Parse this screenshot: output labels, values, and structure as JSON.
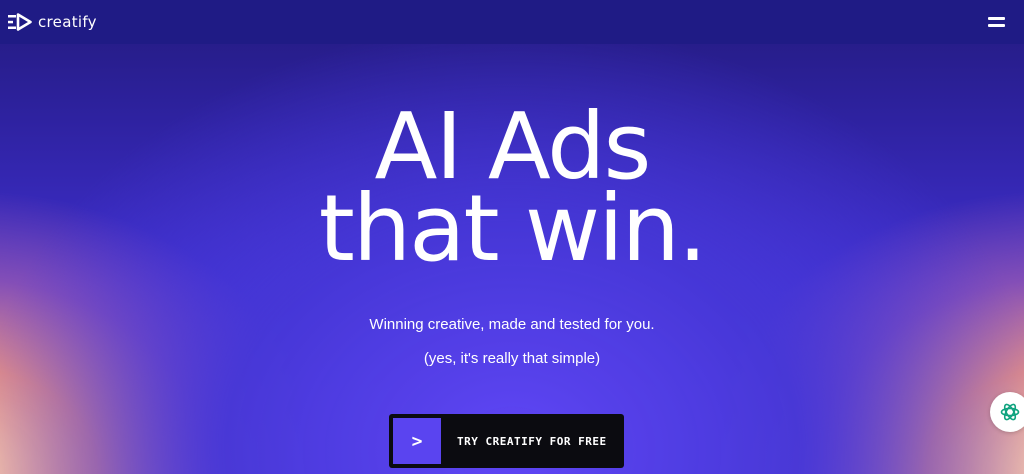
{
  "nav": {
    "brand": "creatify",
    "menu_icon": "hamburger-menu-icon"
  },
  "hero": {
    "title_line1": "AI Ads",
    "title_line2": "that win.",
    "subtitle": "Winning creative, made and tested for you.",
    "tagline": "(yes, it's really that simple)"
  },
  "cta": {
    "icon_glyph": ">",
    "label": "TRY CREATIFY FOR FREE"
  },
  "chat_widget": {
    "icon": "openai-logo-icon"
  },
  "colors": {
    "nav_bg": "#1f1b85",
    "accent": "#5a44f0",
    "cta_bg": "#0b0b10",
    "chat_icon": "#10a37f"
  }
}
